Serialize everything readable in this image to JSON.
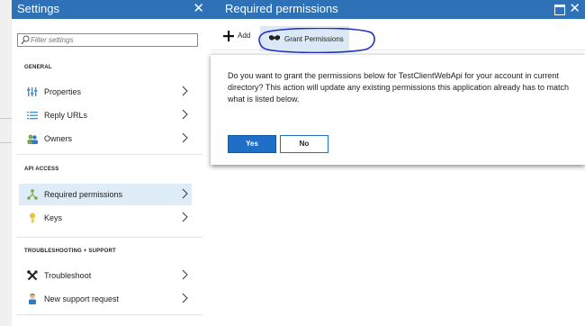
{
  "settings": {
    "title": "Settings",
    "close_glyph": "✕",
    "search": {
      "placeholder": "Filter settings",
      "value": ""
    },
    "sections": {
      "general": "GENERAL",
      "api_access": "API ACCESS",
      "troubleshooting": "TROUBLESHOOTING + SUPPORT"
    },
    "items": [
      {
        "label": "Properties",
        "icon": "properties-icon"
      },
      {
        "label": "Reply URLs",
        "icon": "list-icon"
      },
      {
        "label": "Owners",
        "icon": "users-icon"
      },
      {
        "label": "Required permissions",
        "icon": "network-icon",
        "selected": true
      },
      {
        "label": "Keys",
        "icon": "key-icon"
      },
      {
        "label": "Troubleshoot",
        "icon": "tools-icon"
      },
      {
        "label": "New support request",
        "icon": "support-person-icon"
      }
    ]
  },
  "permissions": {
    "title": "Required permissions",
    "close_glyph": "✕",
    "toolbar": {
      "add_label": "Add",
      "grant_label": "Grant Permissions"
    },
    "dialog": {
      "message": "Do you want to grant the permissions below for TestClientWebApi for your account in current directory? This action will update any existing permissions this application already has to match what is listed below.",
      "yes_label": "Yes",
      "no_label": "No"
    }
  },
  "colors": {
    "header": "#2f71b7",
    "selected": "#ddecf7",
    "accent": "#1f6fc6",
    "annotation": "#1f2fbf"
  }
}
